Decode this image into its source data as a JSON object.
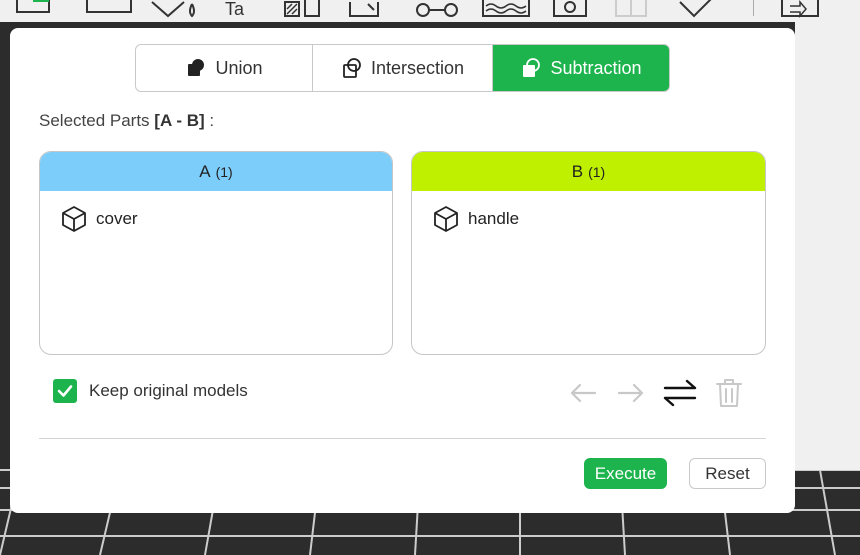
{
  "modes": {
    "union": "Union",
    "intersection": "Intersection",
    "subtraction": "Subtraction",
    "selected": "subtraction"
  },
  "selected_parts": {
    "prefix": "Selected Parts",
    "expression": "[A - B]",
    "suffix": ":"
  },
  "group_a": {
    "title": "A",
    "count": "(1)",
    "color": "#7dcdfa",
    "items": [
      {
        "icon": "cube-icon",
        "label": "cover"
      }
    ]
  },
  "group_b": {
    "title": "B",
    "count": "(1)",
    "color": "#bff000",
    "items": [
      {
        "icon": "cube-icon",
        "label": "handle"
      }
    ]
  },
  "options": {
    "keep_original_label": "Keep original models",
    "keep_original_checked": true
  },
  "action_icons": [
    "arrow-left-icon",
    "arrow-right-icon",
    "swap-icon",
    "trash-icon"
  ],
  "buttons": {
    "execute": "Execute",
    "reset": "Reset"
  },
  "colors": {
    "accent": "#1db34d"
  }
}
